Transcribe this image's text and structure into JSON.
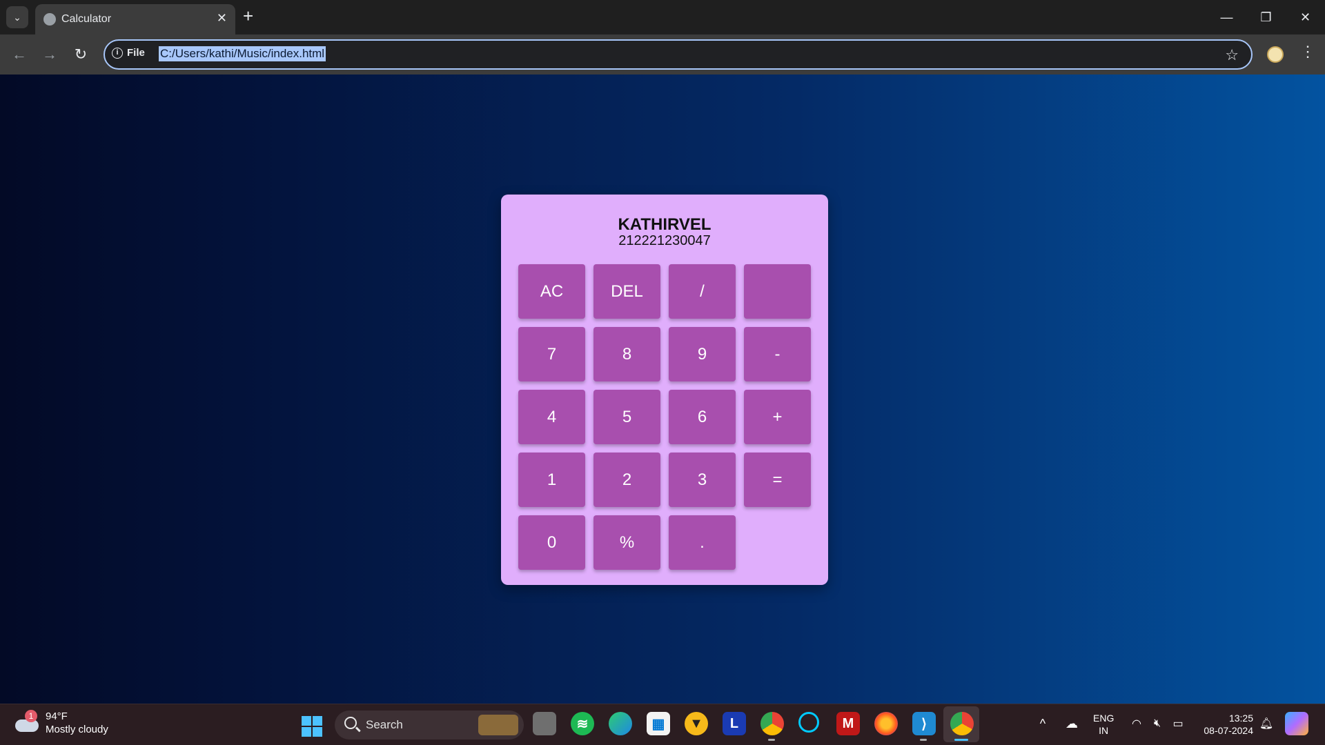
{
  "browser": {
    "tab_title": "Calculator",
    "site_info_label": "File",
    "url": "C:/Users/kathi/Music/index.html"
  },
  "calculator": {
    "name": "KATHIRVEL",
    "id_number": "212221230047",
    "keys": [
      "AC",
      "DEL",
      "/",
      "",
      "7",
      "8",
      "9",
      "-",
      "4",
      "5",
      "6",
      "+",
      "1",
      "2",
      "3",
      "=",
      "0",
      "%",
      "."
    ]
  },
  "taskbar": {
    "weather_badge": "1",
    "weather_temp": "94°F",
    "weather_desc": "Mostly cloudy",
    "search_label": "Search",
    "lang_line1": "ENG",
    "lang_line2": "IN",
    "time": "13:25",
    "date": "08-07-2024",
    "app_l_label": "L"
  },
  "colors": {
    "page_gradient_start": "#030a26",
    "page_gradient_end": "#0353a0",
    "calculator_bg": "#e0aefc",
    "key_bg": "#a84fae",
    "omnibox_focus": "#a8c7fa"
  }
}
